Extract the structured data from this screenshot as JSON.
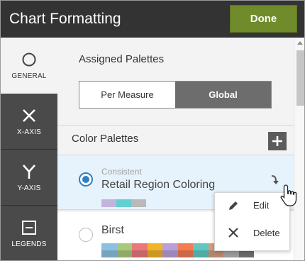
{
  "header": {
    "title": "Chart Formatting",
    "done_label": "Done"
  },
  "rail": {
    "items": [
      {
        "label": "GENERAL",
        "icon": "circle-icon",
        "active": true
      },
      {
        "label": "X-AXIS",
        "icon": "x-icon",
        "active": false
      },
      {
        "label": "Y-AXIS",
        "icon": "y-icon",
        "active": false
      },
      {
        "label": "LEGENDS",
        "icon": "legend-icon",
        "active": false
      }
    ]
  },
  "assigned": {
    "title": "Assigned Palettes",
    "options": [
      "Per Measure",
      "Global"
    ],
    "selected": "Global"
  },
  "palettes": {
    "title": "Color Palettes",
    "add_icon": "plus-icon",
    "items": [
      {
        "subtitle": "Consistent",
        "name": "Retail Region Coloring",
        "selected": true,
        "colors": [
          "#c2b5dd",
          "#64cfd3",
          "#b9b9b9"
        ]
      },
      {
        "subtitle": "",
        "name": "Birst",
        "selected": false,
        "colors": [
          "#8bc1e0",
          "#a9c97a",
          "#e9787a",
          "#f1b327",
          "#b99fdc",
          "#f27c53",
          "#5fc8c0",
          "#d79b7e",
          "#b5b5b5",
          "#7c7c7c"
        ]
      }
    ]
  },
  "menu": {
    "items": [
      {
        "label": "Edit",
        "icon": "pencil-icon"
      },
      {
        "label": "Delete",
        "icon": "close-icon"
      }
    ]
  },
  "colors": {
    "header_bg": "#333333",
    "done_bg": "#6f8b2a",
    "rail_bg": "#4a4a4a",
    "selected_row": "#e6f3fc",
    "radio": "#2f7fc1"
  }
}
